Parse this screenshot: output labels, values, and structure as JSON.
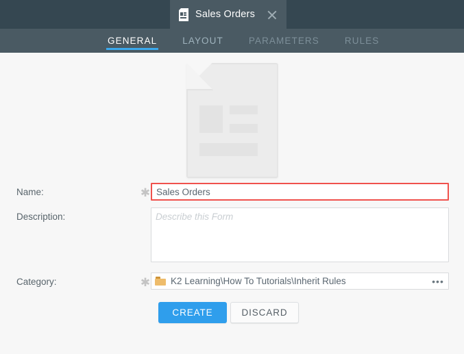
{
  "window": {
    "document_tab": {
      "title": "Sales Orders",
      "icon": "form-document-icon",
      "close_icon": "close-icon"
    }
  },
  "nav": {
    "tabs": [
      {
        "label": "GENERAL",
        "state": "active"
      },
      {
        "label": "LAYOUT",
        "state": "enabled"
      },
      {
        "label": "PARAMETERS",
        "state": "disabled"
      },
      {
        "label": "RULES",
        "state": "disabled"
      }
    ]
  },
  "hero": {
    "icon": "form-document-illustration"
  },
  "form": {
    "name": {
      "label": "Name:",
      "required_marker": "✱",
      "value": "Sales Orders",
      "placeholder": ""
    },
    "description": {
      "label": "Description:",
      "value": "",
      "placeholder": "Describe this Form"
    },
    "category": {
      "label": "Category:",
      "required_marker": "✱",
      "value": "K2 Learning\\How To Tutorials\\Inherit Rules",
      "folder_icon": "folder-icon",
      "browse_label": "•••"
    }
  },
  "actions": {
    "create_label": "CREATE",
    "discard_label": "DISCARD"
  },
  "colors": {
    "topbar": "#354751",
    "tabstrip": "#4a5a63",
    "active_tab_underline": "#3aa9ee",
    "primary_button": "#2f9eec",
    "validation_border": "#f0514c",
    "folder": "#eebc6b",
    "content_bg": "#f7f7f7"
  }
}
